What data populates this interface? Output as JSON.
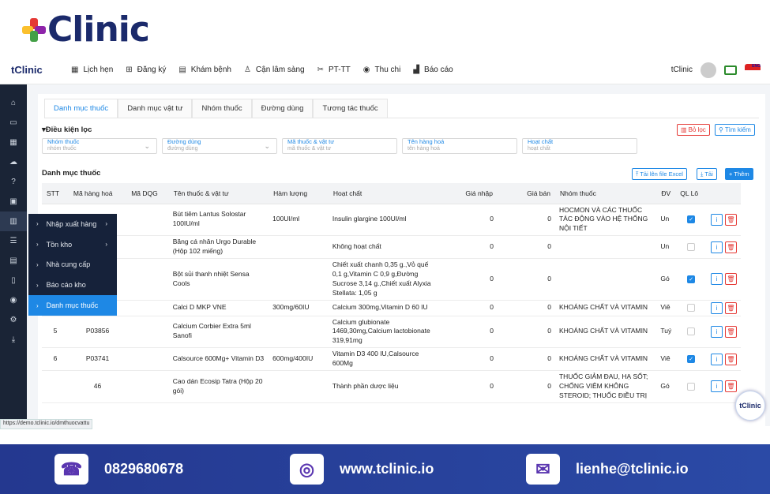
{
  "brand": {
    "big": "Clinic",
    "small": "tClinic"
  },
  "nav": [
    {
      "icon": "calendar-icon",
      "glyph": "▦",
      "label": "Lịch hẹn"
    },
    {
      "icon": "plus-square-icon",
      "glyph": "⊞",
      "label": "Đăng ký"
    },
    {
      "icon": "clipboard-icon",
      "glyph": "▤",
      "label": "Khám bệnh"
    },
    {
      "icon": "flask-icon",
      "glyph": "♙",
      "label": "Cận lâm sàng"
    },
    {
      "icon": "scissors-icon",
      "glyph": "✂",
      "label": "PT-TT"
    },
    {
      "icon": "coin-icon",
      "glyph": "◉",
      "label": "Thu chi"
    },
    {
      "icon": "bar-chart-icon",
      "glyph": "▟",
      "label": "Báo cáo"
    }
  ],
  "user": {
    "name": "tClinic",
    "lang": "ENG"
  },
  "submenu": [
    {
      "label": "Nhập xuất hàng",
      "arrow": true
    },
    {
      "label": "Tồn kho",
      "arrow": true
    },
    {
      "label": "Nhà cung cấp",
      "arrow": false
    },
    {
      "label": "Báo cáo kho",
      "arrow": false
    },
    {
      "label": "Danh mục thuốc",
      "arrow": false,
      "active": true
    }
  ],
  "tabs": [
    "Danh mục thuốc",
    "Danh mục vật tư",
    "Nhóm thuốc",
    "Đường dùng",
    "Tương tác thuốc"
  ],
  "filter": {
    "title": "▾Điều kiện lọc",
    "clear": "Bỏ lọc",
    "search": "Tìm kiếm",
    "fields": [
      {
        "label": "Nhóm thuốc",
        "placeholder": "nhóm thuốc",
        "dropdown": true
      },
      {
        "label": "Đường dùng",
        "placeholder": "đường dùng",
        "dropdown": true
      },
      {
        "label": "Mã thuốc & vật tư",
        "placeholder": "mã thuốc & vật tư",
        "dropdown": false
      },
      {
        "label": "Tên hàng hoá",
        "placeholder": "tên hàng hoá",
        "dropdown": false
      },
      {
        "label": "Hoạt chất",
        "placeholder": "hoạt chất",
        "dropdown": false
      }
    ]
  },
  "section": {
    "title": "Danh mục thuốc",
    "upload": "Tải lên file Excel",
    "download": "Tải",
    "add": "Thêm"
  },
  "columns": [
    "STT",
    "Mã hàng hoá",
    "Mã DQG",
    "Tên thuốc & vật tư",
    "Hàm lượng",
    "Hoạt chất",
    "Giá nhập",
    "Giá bán",
    "Nhóm thuốc",
    "ĐV",
    "QL Lô"
  ],
  "rows": [
    {
      "stt": "",
      "code": "",
      "dqg": "",
      "name": "Bút tiêm Lantus Solostar 100IU/ml",
      "dose": "100UI/ml",
      "active": "Insulin glargine 100UI/ml",
      "buy": "0",
      "sell": "0",
      "group": "HOCMON VÀ CÁC THUỐC TÁC ĐỘNG VÀO HỆ THỐNG NỘI TIẾT",
      "unit": "Un",
      "lot": true
    },
    {
      "stt": "",
      "code": "",
      "dqg": "",
      "name": "Băng cá nhân Urgo Durable (Hộp 102 miếng)",
      "dose": "",
      "active": "Không hoạt chất",
      "buy": "0",
      "sell": "0",
      "group": "",
      "unit": "Un",
      "lot": false
    },
    {
      "stt": "",
      "code": "",
      "dqg": "",
      "name": "Bột sủi thanh nhiệt Sensa Cools",
      "dose": "",
      "active": "Chiết xuất chanh 0,35 g.,Vỏ quế 0,1 g,Vitamin C 0,9 g,Đường Sucrose 3,14 g.,Chiết xuất Alyxia Stellata: 1,05 g",
      "buy": "0",
      "sell": "0",
      "group": "",
      "unit": "Gó",
      "lot": true
    },
    {
      "stt": "4",
      "code": "P00091",
      "dqg": "",
      "name": "Calci D MKP VNE",
      "dose": "300mg/60IU",
      "active": "Calcium 300mg,Vitamin D 60 IU",
      "buy": "0",
      "sell": "0",
      "group": "KHOÁNG CHẤT VÀ VITAMIN",
      "unit": "Viê",
      "lot": false
    },
    {
      "stt": "5",
      "code": "P03856",
      "dqg": "",
      "name": "Calcium Corbier Extra 5ml Sanofi",
      "dose": "",
      "active": "Calcium glubionate 1469,30mg,Calcium lactobionate 319,91mg",
      "buy": "0",
      "sell": "0",
      "group": "KHOÁNG CHẤT VÀ VITAMIN",
      "unit": "Tuý",
      "lot": false
    },
    {
      "stt": "6",
      "code": "P03741",
      "dqg": "",
      "name": "Calsource 600Mg+ Vitamin D3",
      "dose": "600mg/400IU",
      "active": "Vitamin D3 400 IU,Calsource 600Mg",
      "buy": "0",
      "sell": "0",
      "group": "KHOÁNG CHẤT VÀ VITAMIN",
      "unit": "Viê",
      "lot": true
    },
    {
      "stt": "",
      "code": "46",
      "dqg": "",
      "name": "Cao dán Ecosip Tatra (Hộp 20 gói)",
      "dose": "",
      "active": "Thành phần dược liệu",
      "buy": "0",
      "sell": "0",
      "group": "THUỐC GIẢM ĐAU, HẠ SỐT; CHỐNG VIÊM KHÔNG STEROID; THUỐC ĐIỀU TRỊ",
      "unit": "Gó",
      "lot": false
    }
  ],
  "status_url": "https://demo.tclinic.io/dmthuocvattu",
  "float": "tClinic",
  "footer": {
    "phone": "0829680678",
    "web": "www.tclinic.io",
    "email": "lienhe@tclinic.io"
  }
}
